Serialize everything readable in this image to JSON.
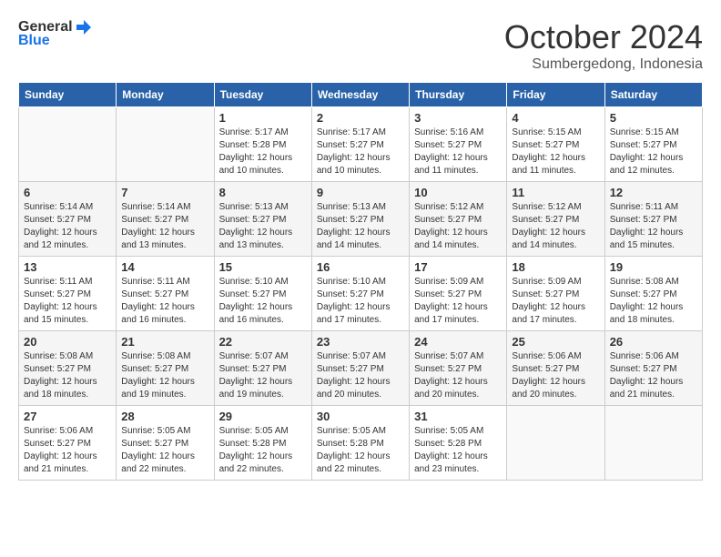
{
  "header": {
    "logo_line1": "General",
    "logo_line2": "Blue",
    "month": "October 2024",
    "location": "Sumbergedong, Indonesia"
  },
  "weekdays": [
    "Sunday",
    "Monday",
    "Tuesday",
    "Wednesday",
    "Thursday",
    "Friday",
    "Saturday"
  ],
  "weeks": [
    [
      {
        "day": "",
        "sunrise": "",
        "sunset": "",
        "daylight": ""
      },
      {
        "day": "",
        "sunrise": "",
        "sunset": "",
        "daylight": ""
      },
      {
        "day": "1",
        "sunrise": "Sunrise: 5:17 AM",
        "sunset": "Sunset: 5:28 PM",
        "daylight": "Daylight: 12 hours and 10 minutes."
      },
      {
        "day": "2",
        "sunrise": "Sunrise: 5:17 AM",
        "sunset": "Sunset: 5:27 PM",
        "daylight": "Daylight: 12 hours and 10 minutes."
      },
      {
        "day": "3",
        "sunrise": "Sunrise: 5:16 AM",
        "sunset": "Sunset: 5:27 PM",
        "daylight": "Daylight: 12 hours and 11 minutes."
      },
      {
        "day": "4",
        "sunrise": "Sunrise: 5:15 AM",
        "sunset": "Sunset: 5:27 PM",
        "daylight": "Daylight: 12 hours and 11 minutes."
      },
      {
        "day": "5",
        "sunrise": "Sunrise: 5:15 AM",
        "sunset": "Sunset: 5:27 PM",
        "daylight": "Daylight: 12 hours and 12 minutes."
      }
    ],
    [
      {
        "day": "6",
        "sunrise": "Sunrise: 5:14 AM",
        "sunset": "Sunset: 5:27 PM",
        "daylight": "Daylight: 12 hours and 12 minutes."
      },
      {
        "day": "7",
        "sunrise": "Sunrise: 5:14 AM",
        "sunset": "Sunset: 5:27 PM",
        "daylight": "Daylight: 12 hours and 13 minutes."
      },
      {
        "day": "8",
        "sunrise": "Sunrise: 5:13 AM",
        "sunset": "Sunset: 5:27 PM",
        "daylight": "Daylight: 12 hours and 13 minutes."
      },
      {
        "day": "9",
        "sunrise": "Sunrise: 5:13 AM",
        "sunset": "Sunset: 5:27 PM",
        "daylight": "Daylight: 12 hours and 14 minutes."
      },
      {
        "day": "10",
        "sunrise": "Sunrise: 5:12 AM",
        "sunset": "Sunset: 5:27 PM",
        "daylight": "Daylight: 12 hours and 14 minutes."
      },
      {
        "day": "11",
        "sunrise": "Sunrise: 5:12 AM",
        "sunset": "Sunset: 5:27 PM",
        "daylight": "Daylight: 12 hours and 14 minutes."
      },
      {
        "day": "12",
        "sunrise": "Sunrise: 5:11 AM",
        "sunset": "Sunset: 5:27 PM",
        "daylight": "Daylight: 12 hours and 15 minutes."
      }
    ],
    [
      {
        "day": "13",
        "sunrise": "Sunrise: 5:11 AM",
        "sunset": "Sunset: 5:27 PM",
        "daylight": "Daylight: 12 hours and 15 minutes."
      },
      {
        "day": "14",
        "sunrise": "Sunrise: 5:11 AM",
        "sunset": "Sunset: 5:27 PM",
        "daylight": "Daylight: 12 hours and 16 minutes."
      },
      {
        "day": "15",
        "sunrise": "Sunrise: 5:10 AM",
        "sunset": "Sunset: 5:27 PM",
        "daylight": "Daylight: 12 hours and 16 minutes."
      },
      {
        "day": "16",
        "sunrise": "Sunrise: 5:10 AM",
        "sunset": "Sunset: 5:27 PM",
        "daylight": "Daylight: 12 hours and 17 minutes."
      },
      {
        "day": "17",
        "sunrise": "Sunrise: 5:09 AM",
        "sunset": "Sunset: 5:27 PM",
        "daylight": "Daylight: 12 hours and 17 minutes."
      },
      {
        "day": "18",
        "sunrise": "Sunrise: 5:09 AM",
        "sunset": "Sunset: 5:27 PM",
        "daylight": "Daylight: 12 hours and 17 minutes."
      },
      {
        "day": "19",
        "sunrise": "Sunrise: 5:08 AM",
        "sunset": "Sunset: 5:27 PM",
        "daylight": "Daylight: 12 hours and 18 minutes."
      }
    ],
    [
      {
        "day": "20",
        "sunrise": "Sunrise: 5:08 AM",
        "sunset": "Sunset: 5:27 PM",
        "daylight": "Daylight: 12 hours and 18 minutes."
      },
      {
        "day": "21",
        "sunrise": "Sunrise: 5:08 AM",
        "sunset": "Sunset: 5:27 PM",
        "daylight": "Daylight: 12 hours and 19 minutes."
      },
      {
        "day": "22",
        "sunrise": "Sunrise: 5:07 AM",
        "sunset": "Sunset: 5:27 PM",
        "daylight": "Daylight: 12 hours and 19 minutes."
      },
      {
        "day": "23",
        "sunrise": "Sunrise: 5:07 AM",
        "sunset": "Sunset: 5:27 PM",
        "daylight": "Daylight: 12 hours and 20 minutes."
      },
      {
        "day": "24",
        "sunrise": "Sunrise: 5:07 AM",
        "sunset": "Sunset: 5:27 PM",
        "daylight": "Daylight: 12 hours and 20 minutes."
      },
      {
        "day": "25",
        "sunrise": "Sunrise: 5:06 AM",
        "sunset": "Sunset: 5:27 PM",
        "daylight": "Daylight: 12 hours and 20 minutes."
      },
      {
        "day": "26",
        "sunrise": "Sunrise: 5:06 AM",
        "sunset": "Sunset: 5:27 PM",
        "daylight": "Daylight: 12 hours and 21 minutes."
      }
    ],
    [
      {
        "day": "27",
        "sunrise": "Sunrise: 5:06 AM",
        "sunset": "Sunset: 5:27 PM",
        "daylight": "Daylight: 12 hours and 21 minutes."
      },
      {
        "day": "28",
        "sunrise": "Sunrise: 5:05 AM",
        "sunset": "Sunset: 5:27 PM",
        "daylight": "Daylight: 12 hours and 22 minutes."
      },
      {
        "day": "29",
        "sunrise": "Sunrise: 5:05 AM",
        "sunset": "Sunset: 5:28 PM",
        "daylight": "Daylight: 12 hours and 22 minutes."
      },
      {
        "day": "30",
        "sunrise": "Sunrise: 5:05 AM",
        "sunset": "Sunset: 5:28 PM",
        "daylight": "Daylight: 12 hours and 22 minutes."
      },
      {
        "day": "31",
        "sunrise": "Sunrise: 5:05 AM",
        "sunset": "Sunset: 5:28 PM",
        "daylight": "Daylight: 12 hours and 23 minutes."
      },
      {
        "day": "",
        "sunrise": "",
        "sunset": "",
        "daylight": ""
      },
      {
        "day": "",
        "sunrise": "",
        "sunset": "",
        "daylight": ""
      }
    ]
  ]
}
